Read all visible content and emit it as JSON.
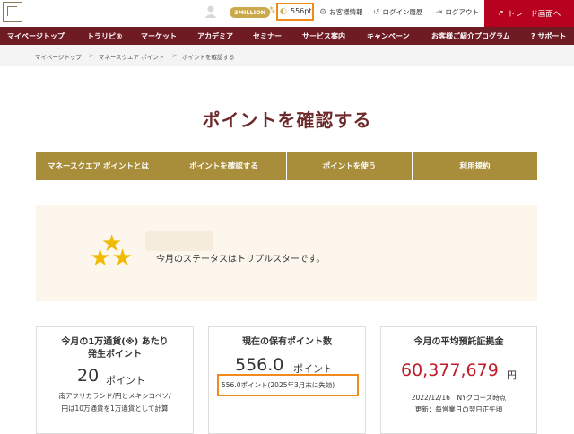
{
  "header": {
    "rank_badge": "3MILLION",
    "points": "556pt",
    "links": [
      {
        "label": "お客様情報"
      },
      {
        "label": "ログイン履歴"
      },
      {
        "label": "ログアウト"
      }
    ],
    "trade_button": "トレード画面へ"
  },
  "nav": {
    "items": [
      {
        "label": "マイページトップ"
      },
      {
        "label": "トラリピ®"
      },
      {
        "label": "マーケット"
      },
      {
        "label": "アカデミア"
      },
      {
        "label": "セミナー"
      },
      {
        "label": "サービス案内"
      },
      {
        "label": "キャンペーン"
      },
      {
        "label": "お客様ご紹介プログラム"
      },
      {
        "label": "サポート"
      }
    ]
  },
  "breadcrumb": {
    "items": [
      "マイページトップ",
      "マネースクエア ポイント",
      "ポイントを確認する"
    ],
    "separator": ">"
  },
  "page": {
    "title": "ポイントを確認する"
  },
  "tabs": [
    {
      "label": "マネースクエア ポイントとは"
    },
    {
      "label": "ポイントを確認する"
    },
    {
      "label": "ポイントを使う"
    },
    {
      "label": "利用規約"
    }
  ],
  "status": {
    "text": "今月のステータスはトリプルスターです。",
    "stars": 3
  },
  "cards": {
    "monthly": {
      "title_line1": "今月の1万通貨(※) あたり",
      "title_line2": "発生ポイント",
      "value": "20",
      "unit": "ポイント",
      "note_line1": "南アフリカランド/円とメキシコペソ/",
      "note_line2": "円は10万通貨を1万通貨として計算"
    },
    "balance": {
      "title": "現在の保有ポイント数",
      "value": "556.0",
      "unit": "ポイント",
      "expiry": "556.0ポイント(2025年3月末に失効)"
    },
    "deposit": {
      "title": "今月の平均預託証拠金",
      "value": "60,377,679",
      "unit": "円",
      "note_line1": "2022/12/16　NYクローズ時点",
      "note_line2": "更新：毎営業日の翌日正午頃"
    }
  },
  "colors": {
    "nav_bg": "#6e1b24",
    "trade_red": "#b8001f",
    "tab_gold": "#a88d3a",
    "highlight_orange": "#f08a1c",
    "star_yellow": "#f0ba00",
    "deposit_red": "#c01a2a"
  }
}
